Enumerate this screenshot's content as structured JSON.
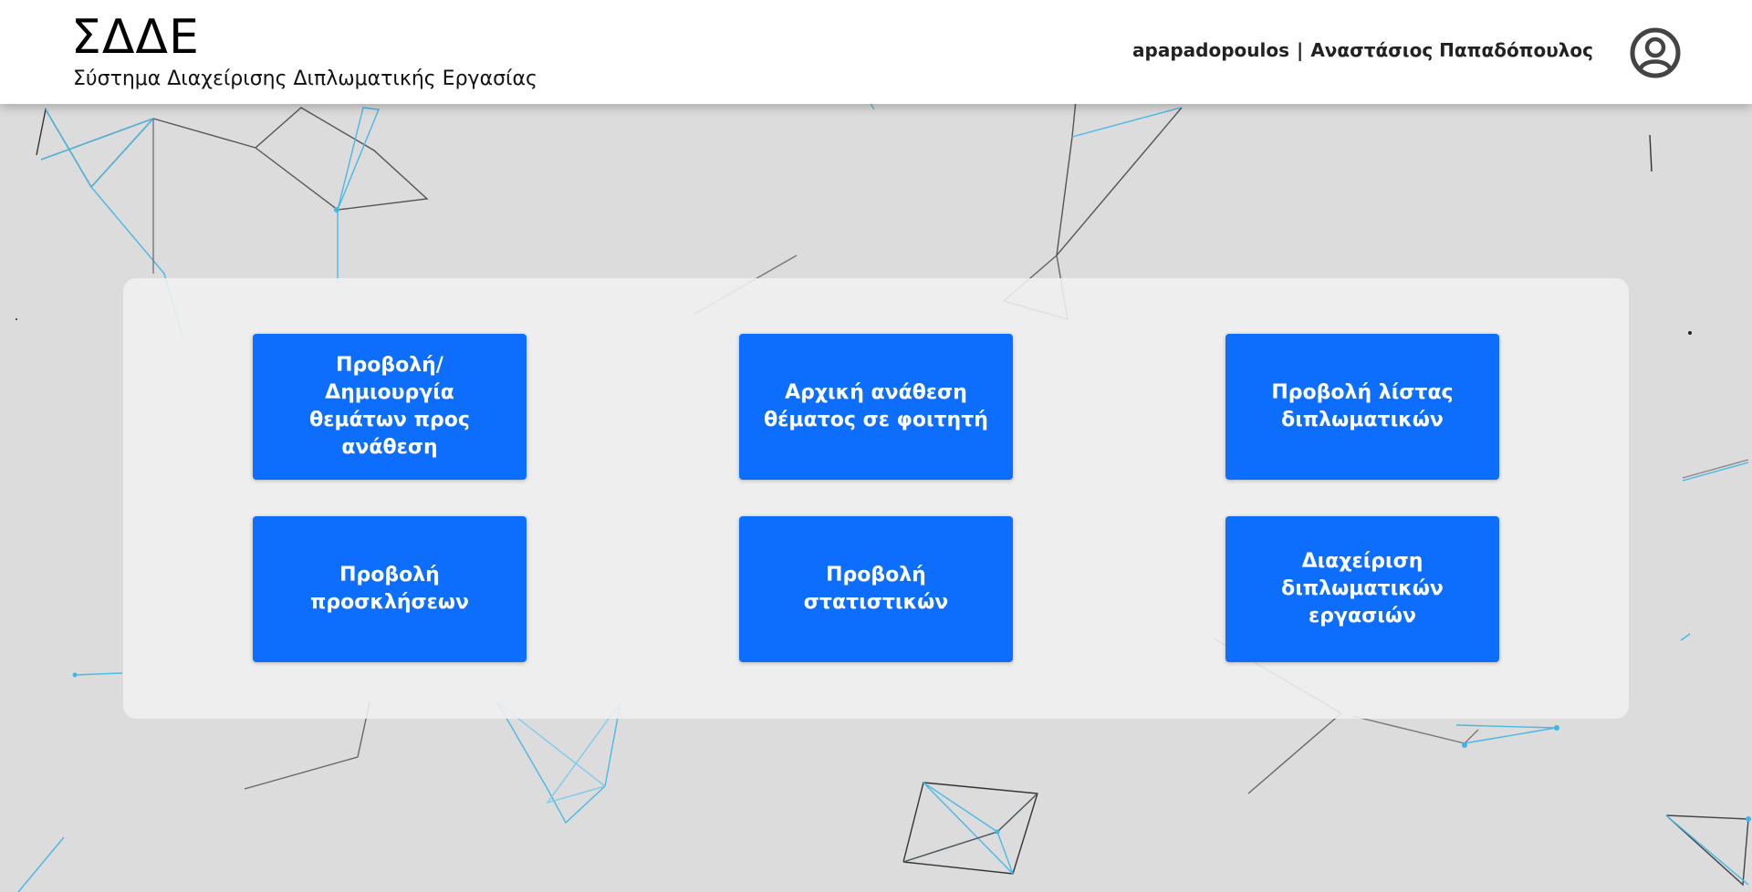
{
  "header": {
    "title": "ΣΔΔΕ",
    "subtitle": "Σύστημα Διαχείρισης Διπλωματικής Εργασίας",
    "username": "apapadopoulos",
    "separator": "|",
    "full_name": "Αναστάσιος Παπαδόπουλος",
    "avatar_icon": "user-circle-icon"
  },
  "menu": {
    "tiles": [
      {
        "label": "Προβολή/Δημιουργία θεμάτων προς ανάθεση"
      },
      {
        "label": "Αρχική ανάθεση θέματος σε φοιτητή"
      },
      {
        "label": "Προβολή λίστας διπλωματικών"
      },
      {
        "label": "Προβολή προσκλήσεων"
      },
      {
        "label": "Προβολή στατιστικών"
      },
      {
        "label": "Διαχείριση διπλωματικών εργασιών"
      }
    ]
  },
  "colors": {
    "accent": "#0d6efd",
    "background": "#dcdcdc",
    "header_bg": "#ffffff",
    "panel_bg": "#f0f0f0",
    "network_blue": "#3fb6e8",
    "network_dark": "#444444"
  }
}
